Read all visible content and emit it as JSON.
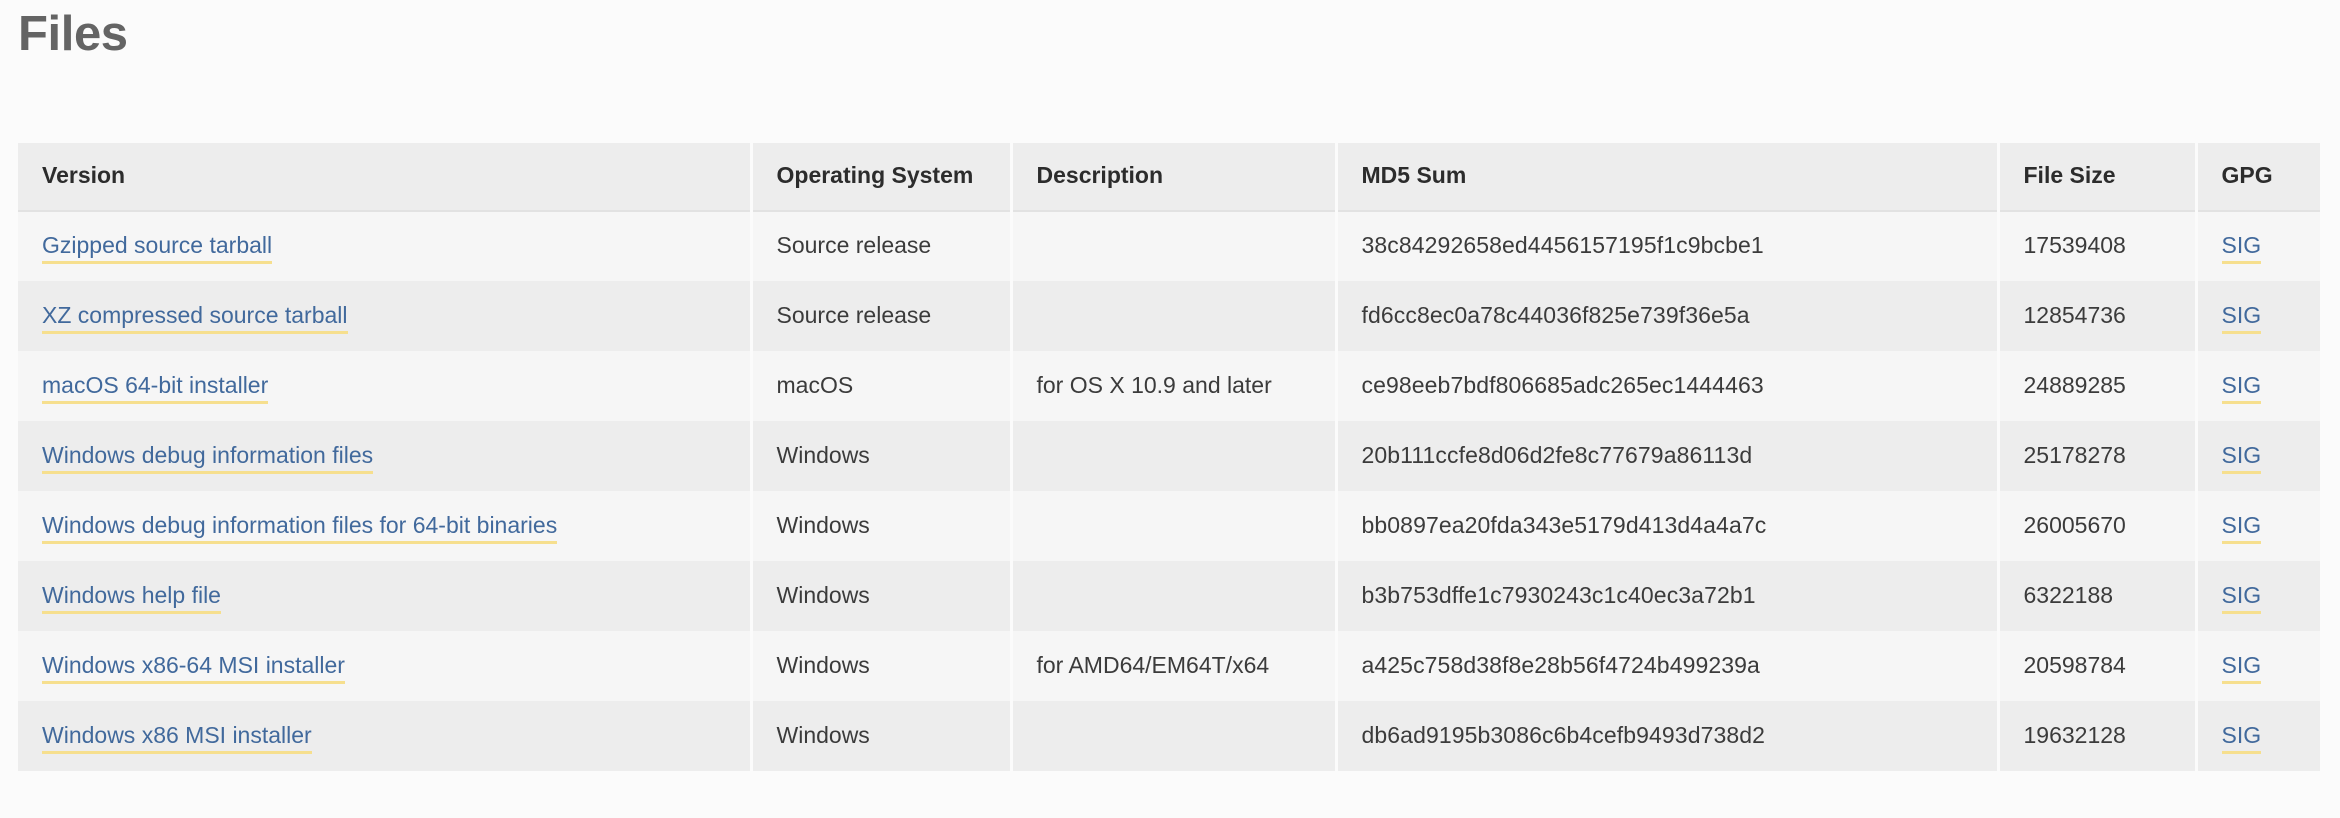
{
  "page": {
    "title": "Files",
    "link_color": "#41699c",
    "link_underline_color": "#f6df8e",
    "header_bg": "#ededed",
    "row_bg_odd": "#f6f6f6",
    "row_bg_even": "#ededed",
    "page_bg": "#fbfbfb",
    "title_color": "#646464"
  },
  "table": {
    "columns": [
      {
        "key": "version",
        "label": "Version"
      },
      {
        "key": "os",
        "label": "Operating System"
      },
      {
        "key": "description",
        "label": "Description"
      },
      {
        "key": "md5",
        "label": "MD5 Sum"
      },
      {
        "key": "filesize",
        "label": "File Size"
      },
      {
        "key": "gpg",
        "label": "GPG"
      }
    ],
    "rows": [
      {
        "version": "Gzipped source tarball",
        "os": "Source release",
        "description": "",
        "md5": "38c84292658ed4456157195f1c9bcbe1",
        "filesize": "17539408",
        "gpg": "SIG"
      },
      {
        "version": "XZ compressed source tarball",
        "os": "Source release",
        "description": "",
        "md5": "fd6cc8ec0a78c44036f825e739f36e5a",
        "filesize": "12854736",
        "gpg": "SIG"
      },
      {
        "version": "macOS 64-bit installer",
        "os": "macOS",
        "description": "for OS X 10.9 and later",
        "md5": "ce98eeb7bdf806685adc265ec1444463",
        "filesize": "24889285",
        "gpg": "SIG"
      },
      {
        "version": "Windows debug information files",
        "os": "Windows",
        "description": "",
        "md5": "20b111ccfe8d06d2fe8c77679a86113d",
        "filesize": "25178278",
        "gpg": "SIG"
      },
      {
        "version": "Windows debug information files for 64-bit binaries",
        "os": "Windows",
        "description": "",
        "md5": "bb0897ea20fda343e5179d413d4a4a7c",
        "filesize": "26005670",
        "gpg": "SIG"
      },
      {
        "version": "Windows help file",
        "os": "Windows",
        "description": "",
        "md5": "b3b753dffe1c7930243c1c40ec3a72b1",
        "filesize": "6322188",
        "gpg": "SIG"
      },
      {
        "version": "Windows x86-64 MSI installer",
        "os": "Windows",
        "description": "for AMD64/EM64T/x64",
        "md5": "a425c758d38f8e28b56f4724b499239a",
        "filesize": "20598784",
        "gpg": "SIG"
      },
      {
        "version": "Windows x86 MSI installer",
        "os": "Windows",
        "description": "",
        "md5": "db6ad9195b3086c6b4cefb9493d738d2",
        "filesize": "19632128",
        "gpg": "SIG"
      }
    ]
  }
}
